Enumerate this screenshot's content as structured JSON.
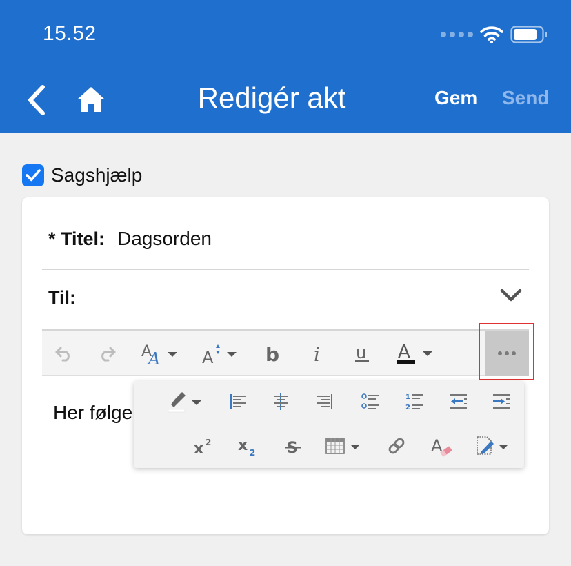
{
  "status_bar": {
    "time": "15.52"
  },
  "nav": {
    "title": "Redigér akt",
    "save_label": "Gem",
    "send_label": "Send"
  },
  "help": {
    "label": "Sagshjælp",
    "checked": true
  },
  "form": {
    "title_label": "* Titel:",
    "title_value": "Dagsorden",
    "to_label": "Til:"
  },
  "editor": {
    "body_text": "Her følge"
  },
  "colors": {
    "primary": "#1f6fce",
    "checkbox": "#1677f2",
    "send_disabled": "#8fb7ec",
    "highlight": "#e03131",
    "icon_blue": "#3b78c2"
  },
  "toolbar_icons": [
    "undo-icon",
    "redo-icon",
    "font-family-icon",
    "font-size-icon",
    "bold-icon",
    "italic-icon",
    "underline-icon",
    "text-color-icon",
    "more-icon"
  ],
  "popup_icons": [
    "highlight-color-icon",
    "align-left-icon",
    "align-center-icon",
    "align-right-icon",
    "bullet-list-icon",
    "numbered-list-icon",
    "outdent-icon",
    "indent-icon",
    "superscript-icon",
    "subscript-icon",
    "strikethrough-icon",
    "table-icon",
    "link-icon",
    "clear-format-icon",
    "insert-signature-icon"
  ]
}
